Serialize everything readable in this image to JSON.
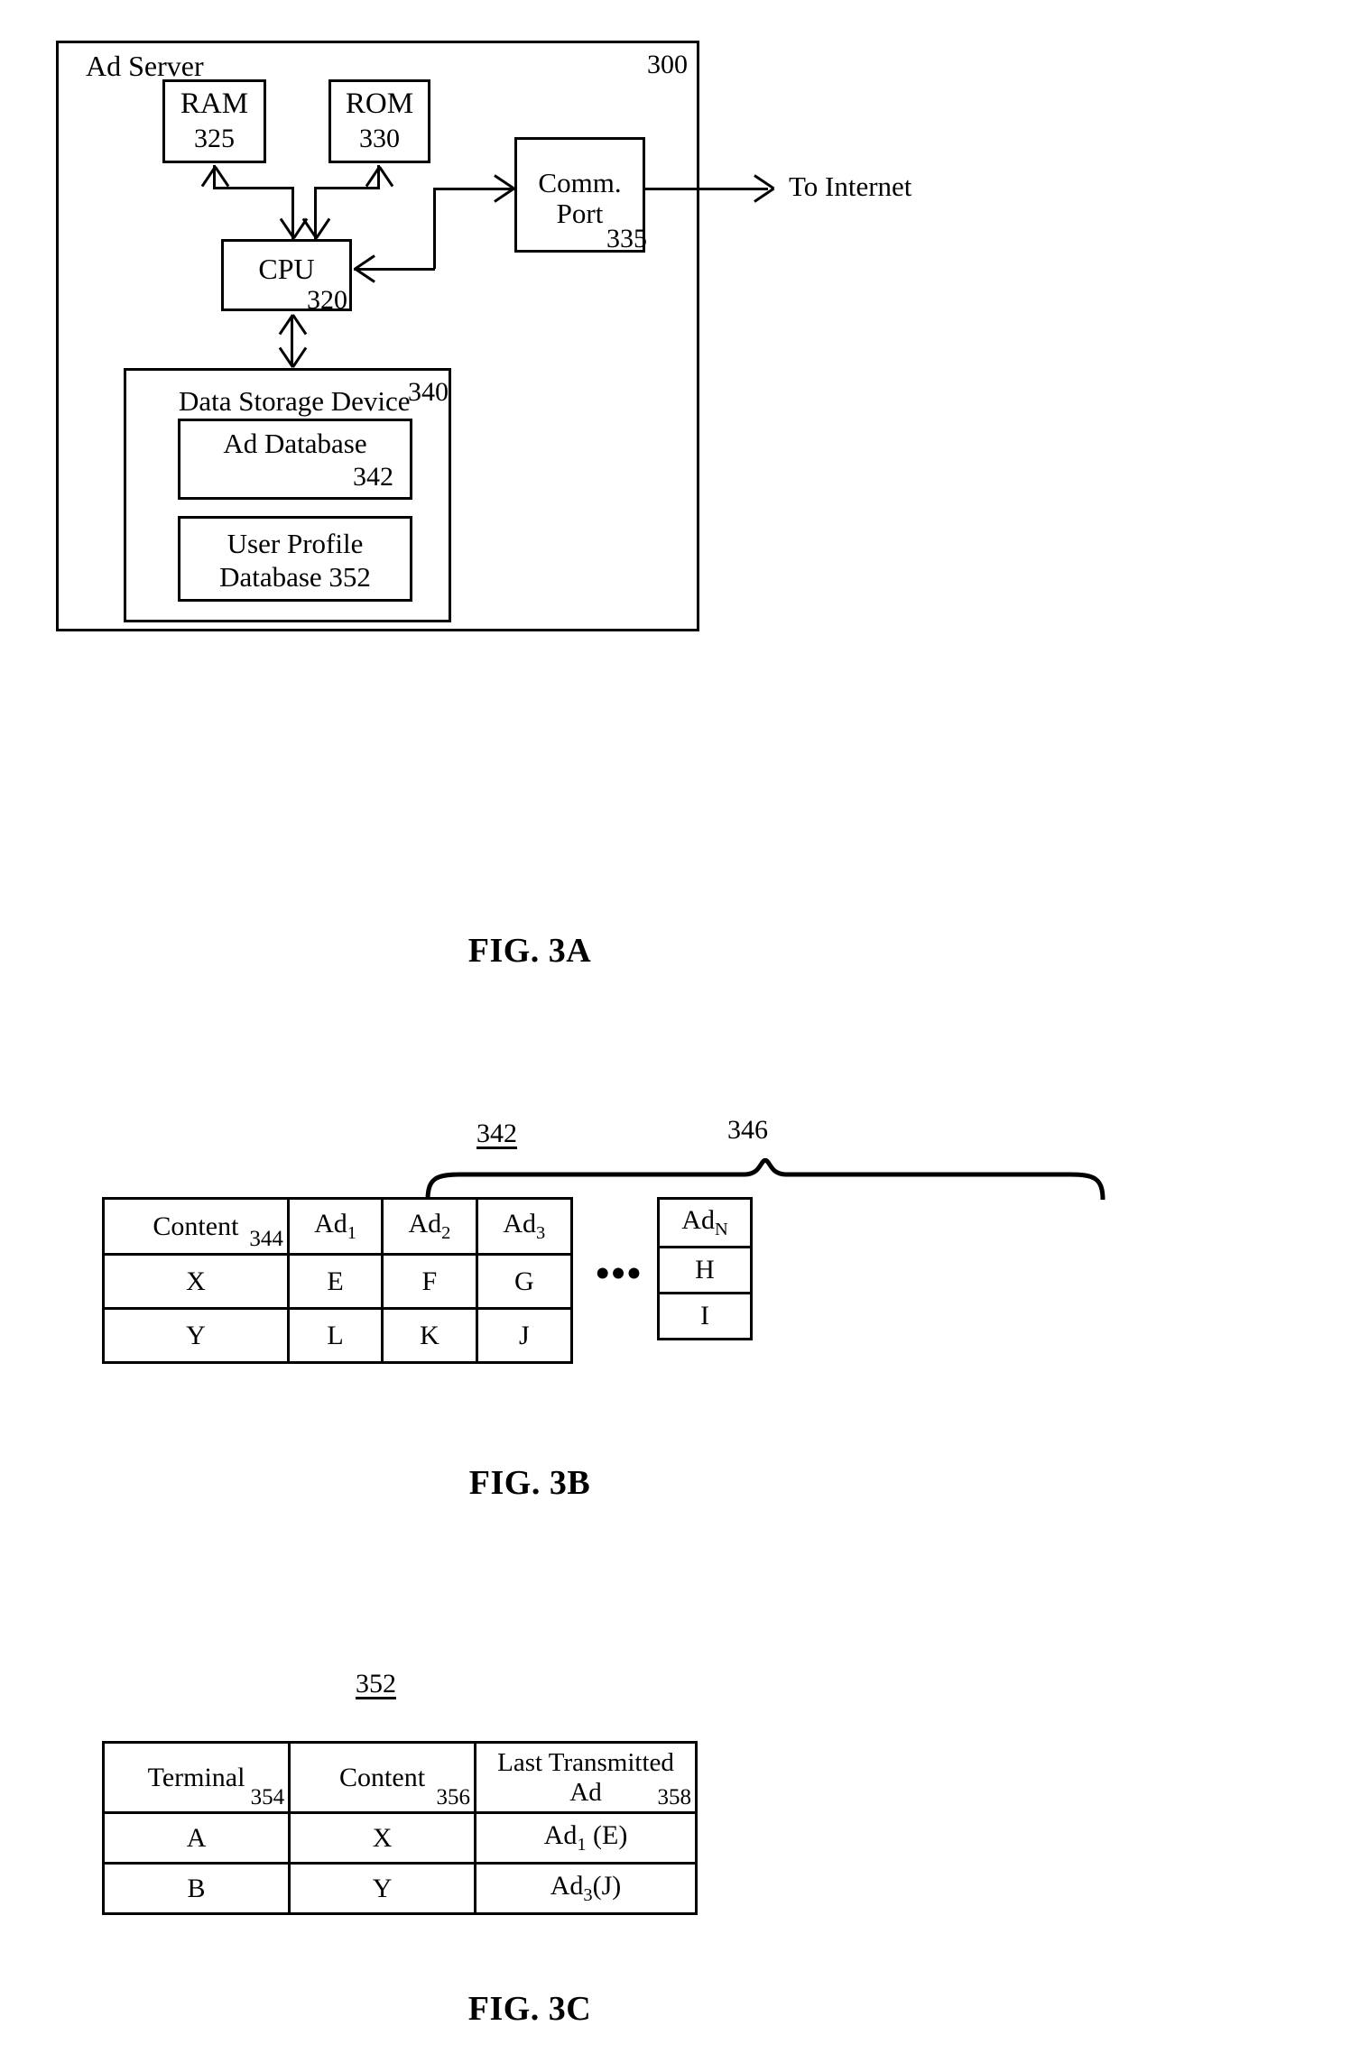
{
  "figures": [
    {
      "caption": "FIG. 3A",
      "title": "Ad Server",
      "ref": "300",
      "blocks": [
        {
          "name": "ram",
          "label": "RAM",
          "ref": "325"
        },
        {
          "name": "rom",
          "label": "ROM",
          "ref": "330"
        },
        {
          "name": "comm_port",
          "label_line1": "Comm.",
          "label_line2": "Port",
          "ref": "335"
        },
        {
          "name": "cpu",
          "label": "CPU",
          "ref": "320"
        },
        {
          "name": "data_storage_device",
          "label": "Data Storage Device",
          "ref": "340"
        },
        {
          "name": "ad_database",
          "label": "Ad Database",
          "ref": "342"
        },
        {
          "name": "user_profile_database",
          "label_line1": "User Profile",
          "label_line2": "Database 352",
          "ref": "352"
        }
      ],
      "external_label": "To Internet"
    },
    {
      "caption": "FIG. 3B",
      "ref_left": "342",
      "ref_brace": "346",
      "ellipsis": "•••",
      "table": {
        "headers": [
          {
            "text": "Content",
            "ref": "344"
          },
          {
            "text": "Ad",
            "subscript": "1"
          },
          {
            "text": "Ad",
            "subscript": "2"
          },
          {
            "text": "Ad",
            "subscript": "3"
          }
        ],
        "rows": [
          [
            "X",
            "E",
            "F",
            "G"
          ],
          [
            "Y",
            "L",
            "K",
            "J"
          ]
        ],
        "tail": {
          "header": {
            "text": "Ad",
            "subscript": "N"
          },
          "values": [
            "H",
            "I"
          ]
        }
      }
    },
    {
      "caption": "FIG. 3C",
      "ref_top": "352",
      "table": {
        "headers": [
          {
            "text": "Terminal",
            "ref": "354"
          },
          {
            "text": "Content",
            "ref": "356"
          },
          {
            "line1": "Last Transmitted",
            "line2": "Ad",
            "ref": "358"
          }
        ],
        "rows": [
          {
            "terminal": "A",
            "content": "X",
            "ad_base": "Ad",
            "ad_sub": "1",
            "ad_tail": " (E)"
          },
          {
            "terminal": "B",
            "content": "Y",
            "ad_base": "Ad",
            "ad_sub": "3",
            "ad_tail": "(J)"
          }
        ]
      }
    }
  ]
}
